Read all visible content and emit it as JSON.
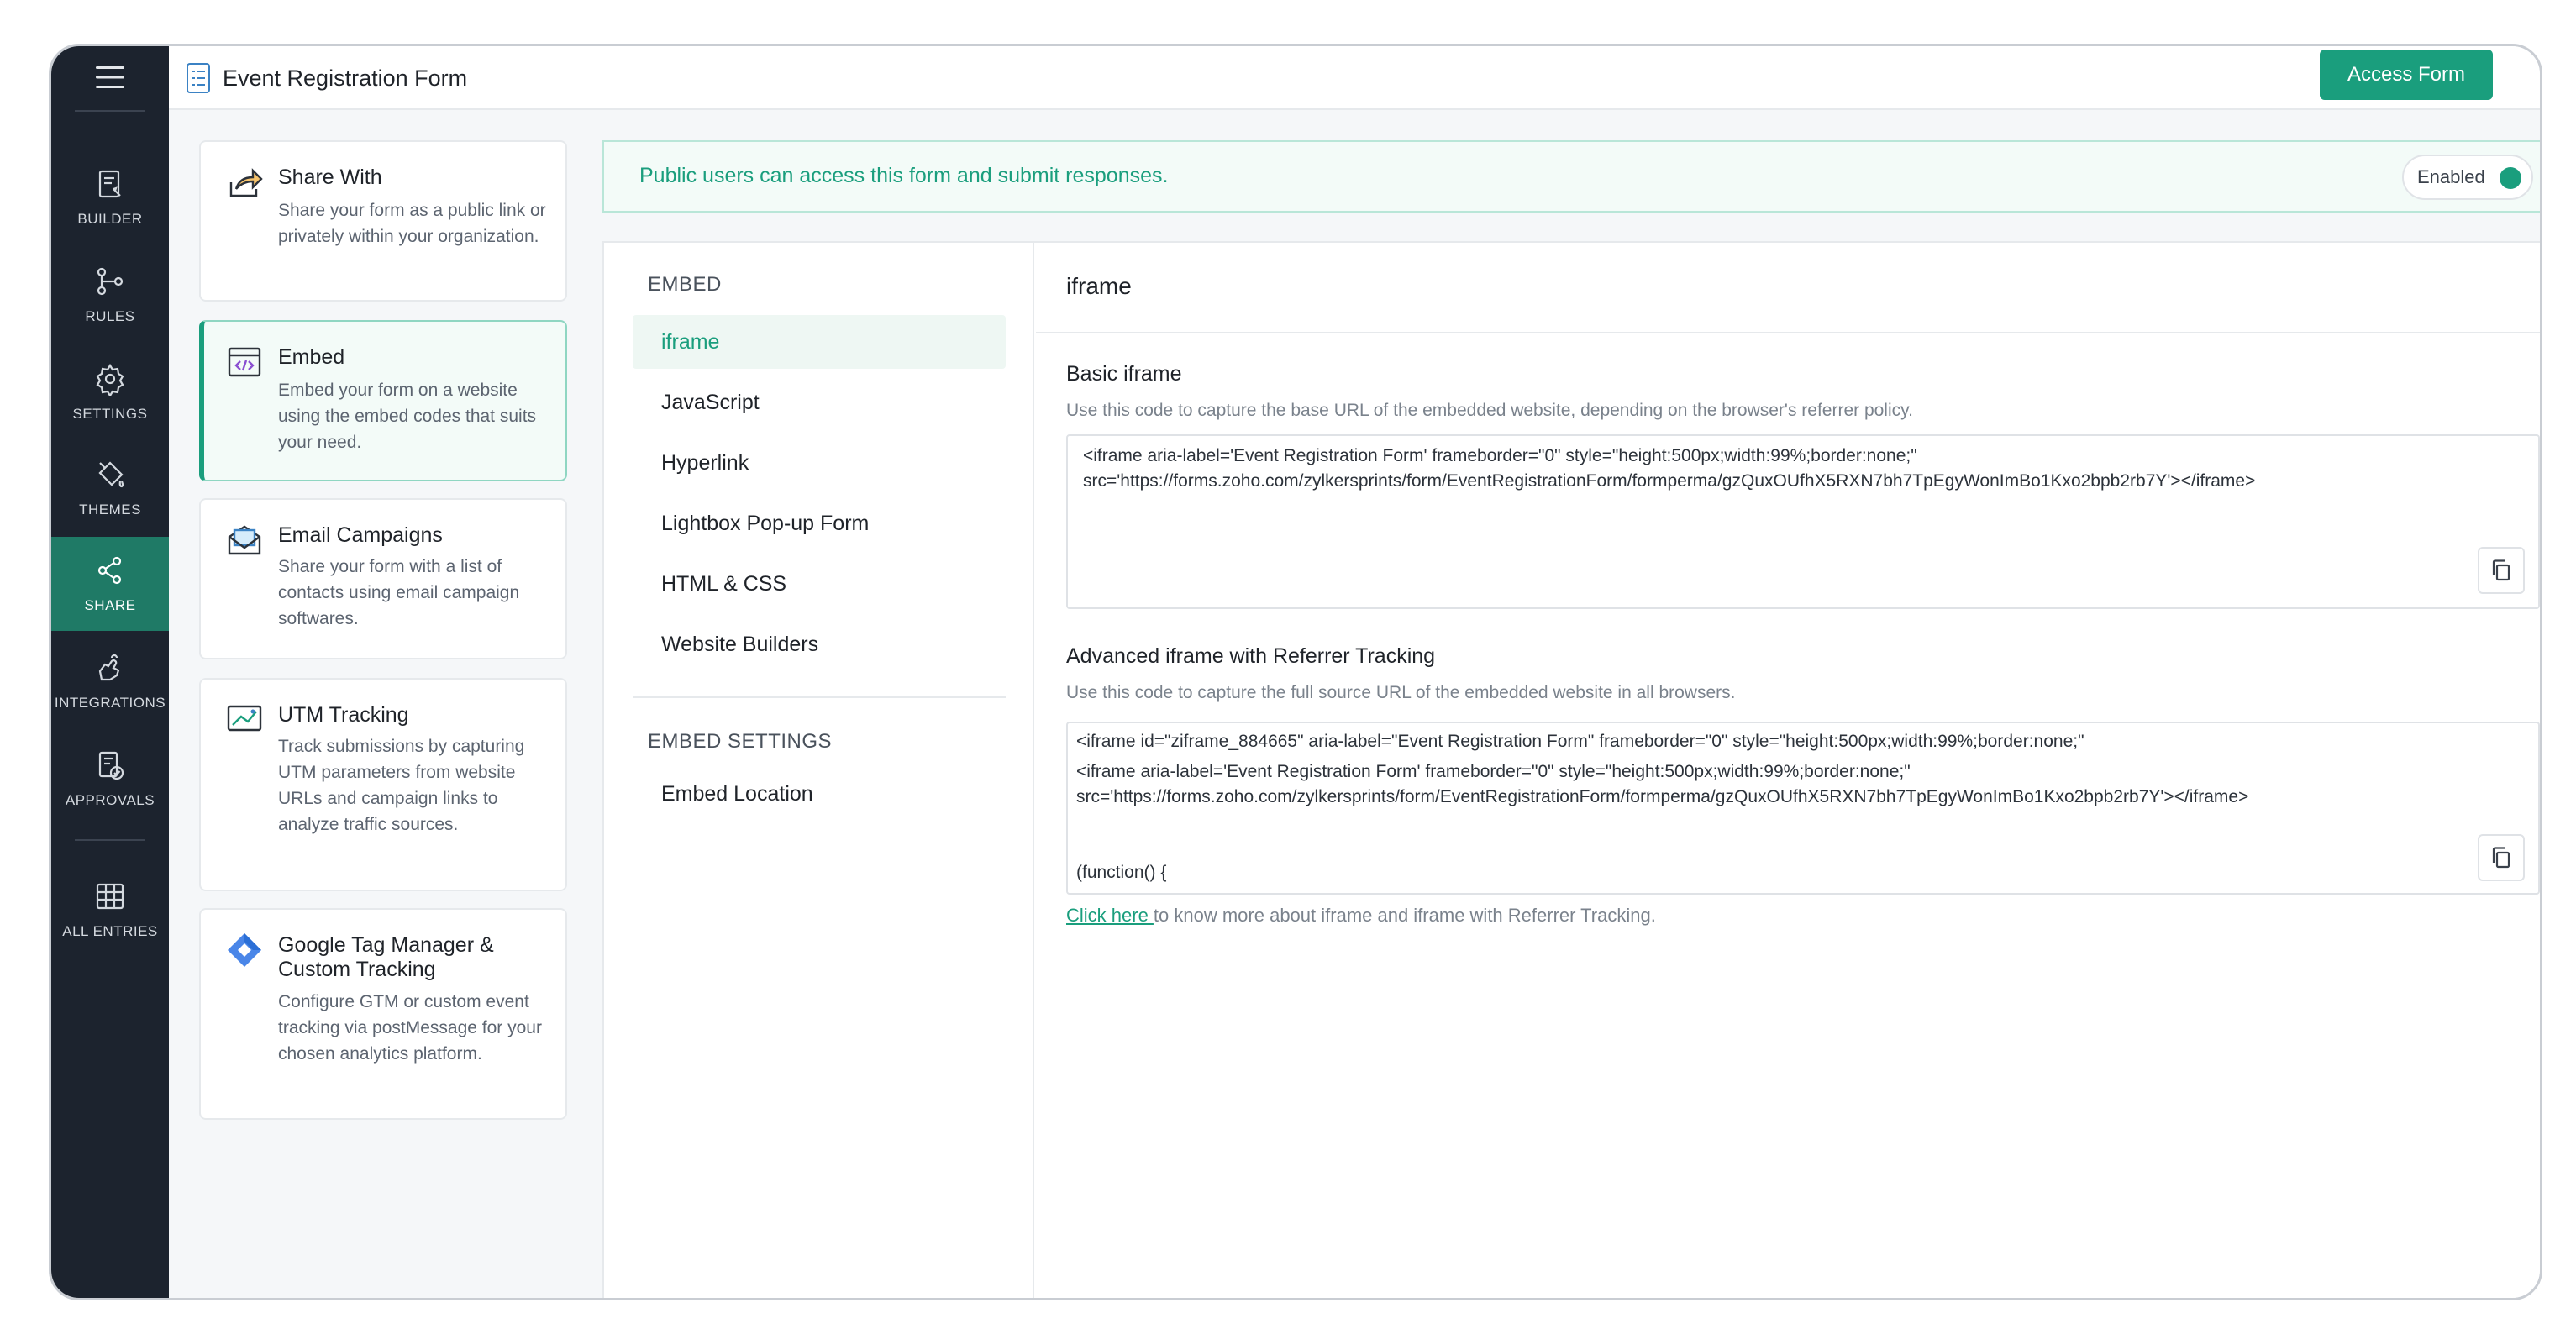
{
  "header": {
    "form_title": "Event Registration Form",
    "access_button": "Access Form"
  },
  "rail": {
    "items": [
      {
        "label": "BUILDER",
        "icon": "builder-icon"
      },
      {
        "label": "RULES",
        "icon": "rules-icon"
      },
      {
        "label": "SETTINGS",
        "icon": "gear-icon"
      },
      {
        "label": "THEMES",
        "icon": "paint-bucket-icon"
      },
      {
        "label": "SHARE",
        "icon": "share-icon",
        "active": true
      },
      {
        "label": "INTEGRATIONS",
        "icon": "puzzle-icon"
      },
      {
        "label": "APPROVALS",
        "icon": "approval-icon"
      },
      {
        "label": "ALL ENTRIES",
        "icon": "table-icon"
      }
    ]
  },
  "share_options": [
    {
      "title": "Share With",
      "desc": "Share your form as a public link or privately within your organization.",
      "icon": "share-arrow-icon"
    },
    {
      "title": "Embed",
      "desc": "Embed your form on a website using the embed codes that suits your need.",
      "icon": "code-icon",
      "active": true
    },
    {
      "title": "Email Campaigns",
      "desc": "Share your form with a list of contacts using email campaign softwares.",
      "icon": "email-icon"
    },
    {
      "title": "UTM Tracking",
      "desc": "Track submissions by capturing UTM parameters from website URLs and campaign links to analyze traffic sources.",
      "icon": "chart-image-icon"
    },
    {
      "title": "Google Tag Manager & Custom Tracking",
      "desc": "Configure GTM or custom event tracking via postMessage for your chosen analytics platform.",
      "icon": "gtm-diamond-icon"
    }
  ],
  "banner": {
    "text": "Public users can access this form and submit responses.",
    "toggle_label": "Enabled"
  },
  "embed_nav": {
    "heading": "EMBED",
    "items": [
      "iframe",
      "JavaScript",
      "Hyperlink",
      "Lightbox Pop-up Form",
      "HTML & CSS",
      "Website Builders"
    ],
    "settings_heading": "EMBED SETTINGS",
    "settings_items": [
      "Embed Location"
    ]
  },
  "content": {
    "title": "iframe",
    "basic": {
      "title": "Basic iframe",
      "desc": "Use this code to capture the base URL of the embedded website, depending on the browser's referrer policy.",
      "code_lines": [
        "<iframe aria-label='Event Registration Form' frameborder=\"0\" style=\"height:500px;width:99%;border:none;\"",
        "src='https://forms.zoho.com/zylkersprints/form/EventRegistrationForm/formperma/gzQuxOUfhX5RXN7bh7TpEgyWonImBo1Kxo2bpb2rb7Y'></iframe>"
      ]
    },
    "advanced": {
      "title": "Advanced iframe with Referrer Tracking",
      "desc": "Use this code to capture the full source URL of the embedded website in all browsers.",
      "code_lines": [
        "<iframe id=\"ziframe_884665\" aria-label=\"Event Registration Form\" frameborder=\"0\"     style=\"height:500px;width:99%;border:none;\"",
        "<iframe aria-label='Event Registration Form' frameborder=\"0\" style=\"height:500px;width:99%;border:none;\"",
        "src='https://forms.zoho.com/zylkersprints/form/EventRegistrationForm/formperma/gzQuxOUfhX5RXN7bh7TpEgyWonImBo1Kxo2bpb2rb7Y'></iframe>",
        "(function() {"
      ]
    },
    "help_link": "Click here ",
    "help_text": "to know more about iframe and iframe with Referrer Tracking."
  },
  "colors": {
    "accent": "#1a9e7d",
    "rail_bg": "#1c232e",
    "rail_active": "#1f7a66"
  }
}
